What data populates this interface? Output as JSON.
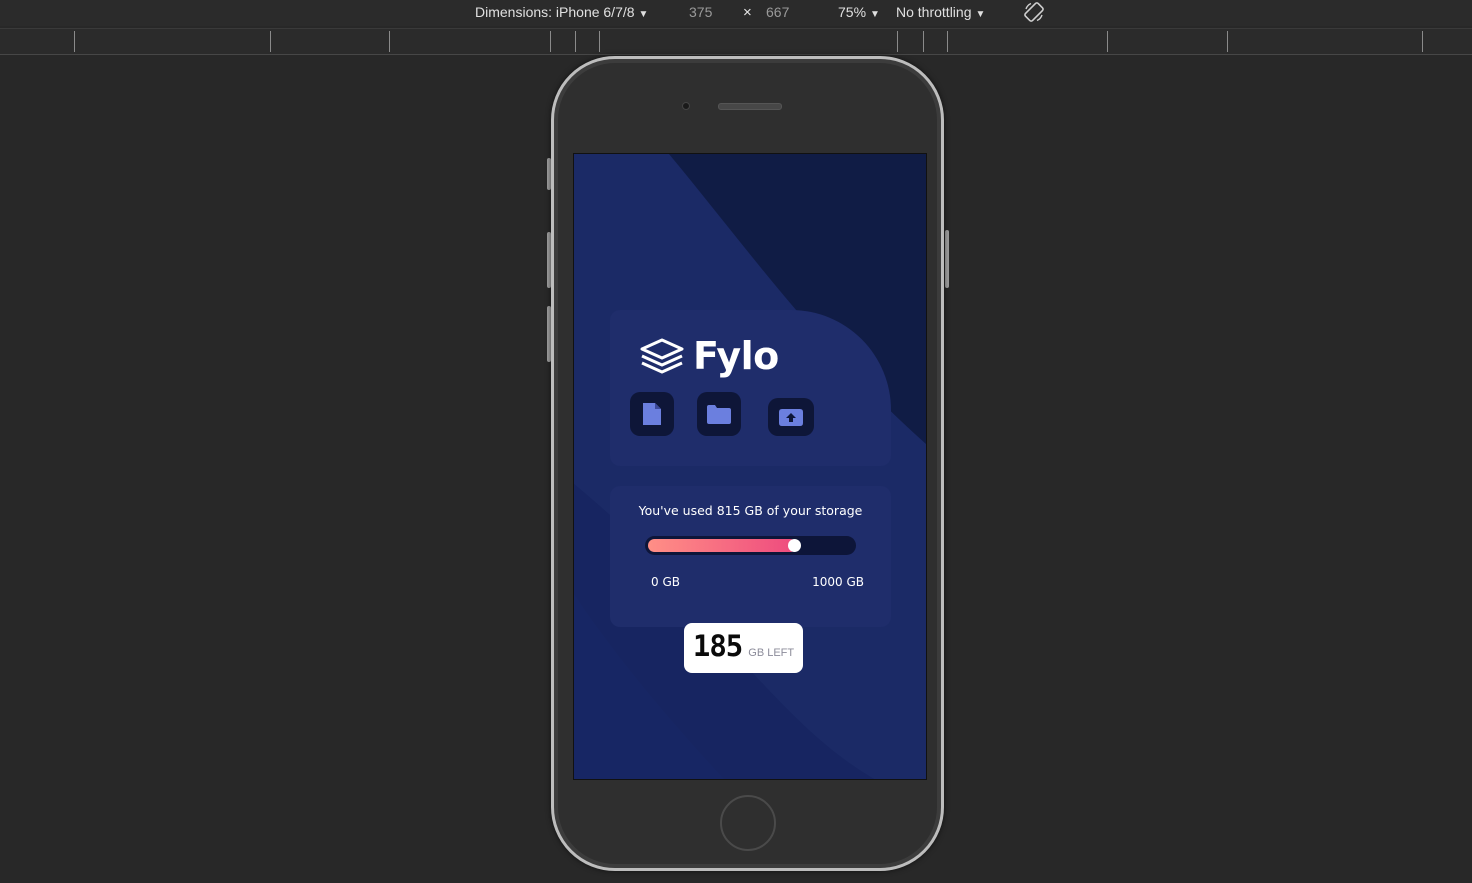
{
  "devtools": {
    "dimensions_label": "Dimensions: iPhone 6/7/8",
    "width_value": "375",
    "times_symbol": "×",
    "height_value": "667",
    "zoom_label": "75%",
    "throttling_label": "No throttling",
    "rotate_icon": "rotate-icon"
  },
  "app": {
    "brand": "Fylo",
    "logo_icon": "layers-icon",
    "actions": [
      {
        "icon": "document-icon"
      },
      {
        "icon": "folder-icon"
      },
      {
        "icon": "upload-icon"
      }
    ],
    "usage": {
      "text": "You've used 815 GB of your storage",
      "used_gb": 815,
      "total_gb": 1000,
      "min_label": "0 GB",
      "max_label": "1000 GB"
    },
    "remaining": {
      "number": "185",
      "label": "GB LEFT"
    }
  },
  "colors": {
    "background": "#1b2a66",
    "card": "#1f2d6b",
    "icon_button": "#0e1638",
    "bar_start": "#ff8f86",
    "bar_end": "#ee4a7e",
    "icon_accent": "#6b7fdf"
  }
}
